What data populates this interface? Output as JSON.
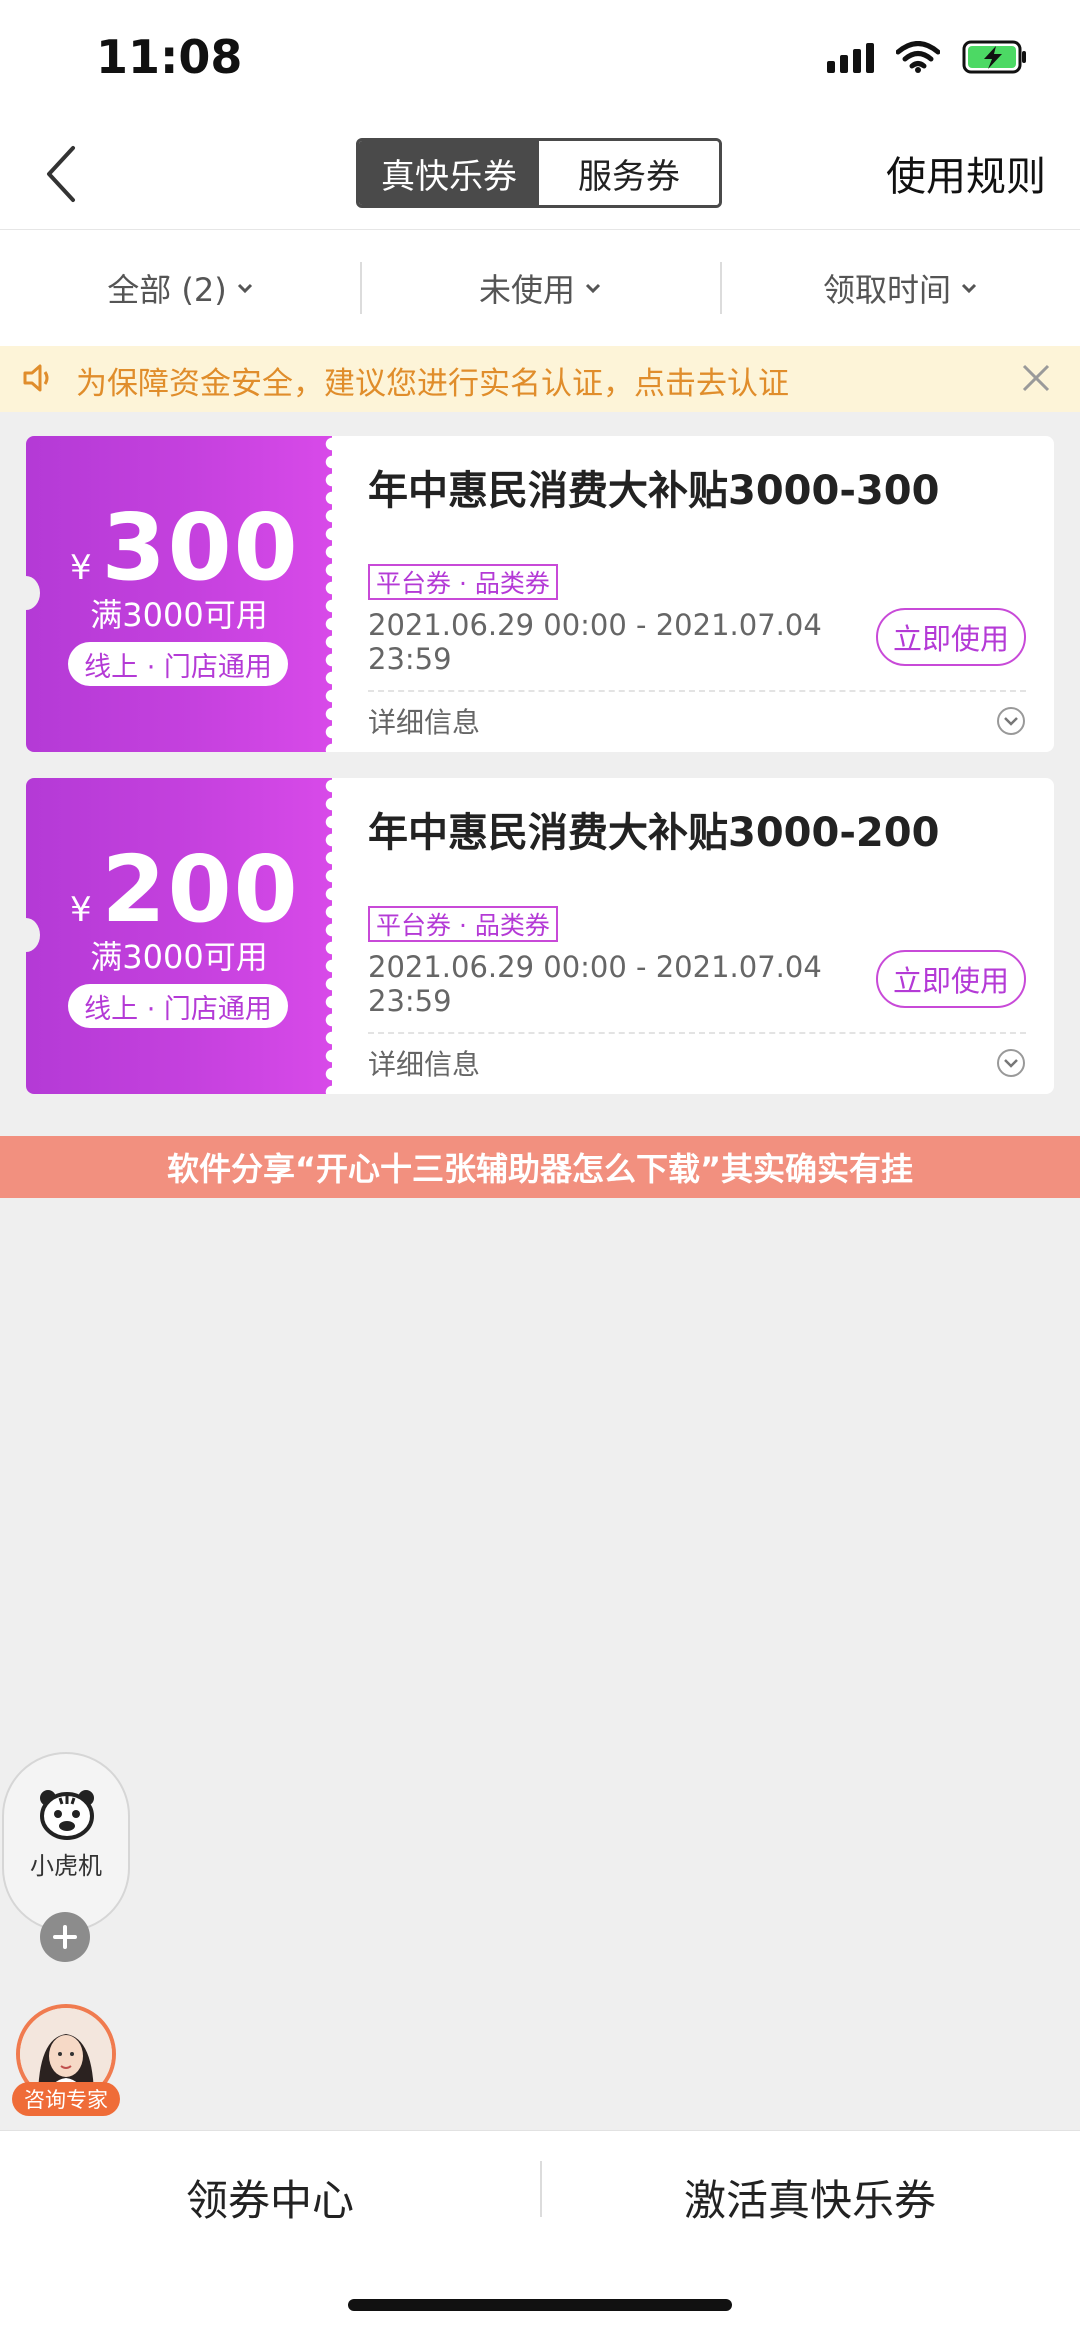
{
  "status_bar": {
    "time": "11:08"
  },
  "nav": {
    "tabs": [
      {
        "label": "真快乐券",
        "active": true
      },
      {
        "label": "服务券",
        "active": false
      }
    ],
    "rules_label": "使用规则"
  },
  "filters": [
    {
      "label": "全部 (2)"
    },
    {
      "label": "未使用"
    },
    {
      "label": "领取时间"
    }
  ],
  "notice": {
    "text": "为保障资金安全，建议您进行实名认证，点击去认证"
  },
  "coupons": [
    {
      "currency": "¥",
      "amount": "300",
      "threshold": "满3000可用",
      "scope": "线上 · 门店通用",
      "title": "年中惠民消费大补贴3000-300",
      "tag": "平台券 · 品类券",
      "validity_line1": "2021.06.29 00:00 - 2021.07.04",
      "validity_line2": "23:59",
      "use_label": "立即使用",
      "details_label": "详细信息"
    },
    {
      "currency": "¥",
      "amount": "200",
      "threshold": "满3000可用",
      "scope": "线上 · 门店通用",
      "title": "年中惠民消费大补贴3000-200",
      "tag": "平台券 · 品类券",
      "validity_line1": "2021.06.29 00:00 - 2021.07.04",
      "validity_line2": "23:59",
      "use_label": "立即使用",
      "details_label": "详细信息"
    }
  ],
  "banner": {
    "text": "软件分享“开心十三张辅助器怎么下载”其实确实有挂"
  },
  "floating": {
    "tiger_label": "小虎机",
    "expert_label": "咨询专家"
  },
  "bottom_bar": {
    "left_label": "领券中心",
    "right_label": "激活真快乐券"
  },
  "colors": {
    "accent": "#c541de",
    "notice_text": "#e08d2b",
    "notice_bg": "#fdf4d8",
    "banner_bg": "#f2907f"
  }
}
